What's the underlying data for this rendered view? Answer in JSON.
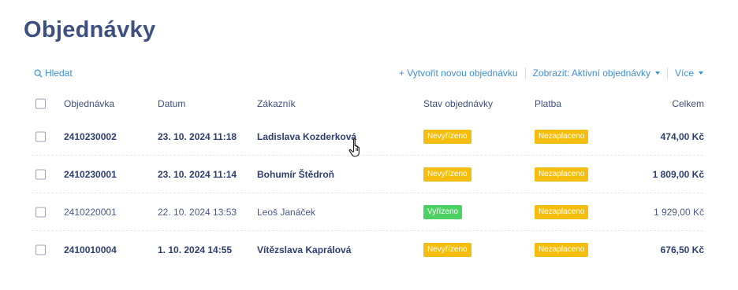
{
  "page": {
    "title": "Objednávky"
  },
  "toolbar": {
    "search_label": "Hledat",
    "create_label": "+ Vytvořit novou objednávku",
    "view_label": "Zobrazit: Aktivní objednávky",
    "more_label": "Více",
    "accent_color": "#3d8fd6"
  },
  "table": {
    "columns": {
      "order": "Objednávka",
      "date": "Datum",
      "customer": "Zákazník",
      "state": "Stav objednávky",
      "payment": "Platba",
      "total": "Celkem"
    },
    "rows": [
      {
        "order": "2410230002",
        "date": "23. 10. 2024 11:18",
        "customer": "Ladislava Kozderková",
        "state": "Nevyřízeno",
        "payment": "Nezaplaceno",
        "total": "474,00 Kč"
      },
      {
        "order": "2410230001",
        "date": "23. 10. 2024 11:14",
        "customer": "Bohumír Štědroň",
        "state": "Nevyřízeno",
        "payment": "Nezaplaceno",
        "total": "1 809,00 Kč"
      },
      {
        "order": "2410220001",
        "date": "22. 10. 2024 13:53",
        "customer": "Leoš Janáček",
        "state": "Vyřízeno",
        "payment": "Nezaplaceno",
        "total": "1 929,00 Kč"
      },
      {
        "order": "2410010004",
        "date": "1. 10. 2024 14:55",
        "customer": "Vítězslava Kaprálová",
        "state": "Nevyřízeno",
        "payment": "Nezaplaceno",
        "total": "676,50 Kč"
      }
    ]
  },
  "colors": {
    "badge_yellow": "#f5bd0e",
    "badge_green": "#4cd263",
    "title": "#3d4f7f"
  }
}
